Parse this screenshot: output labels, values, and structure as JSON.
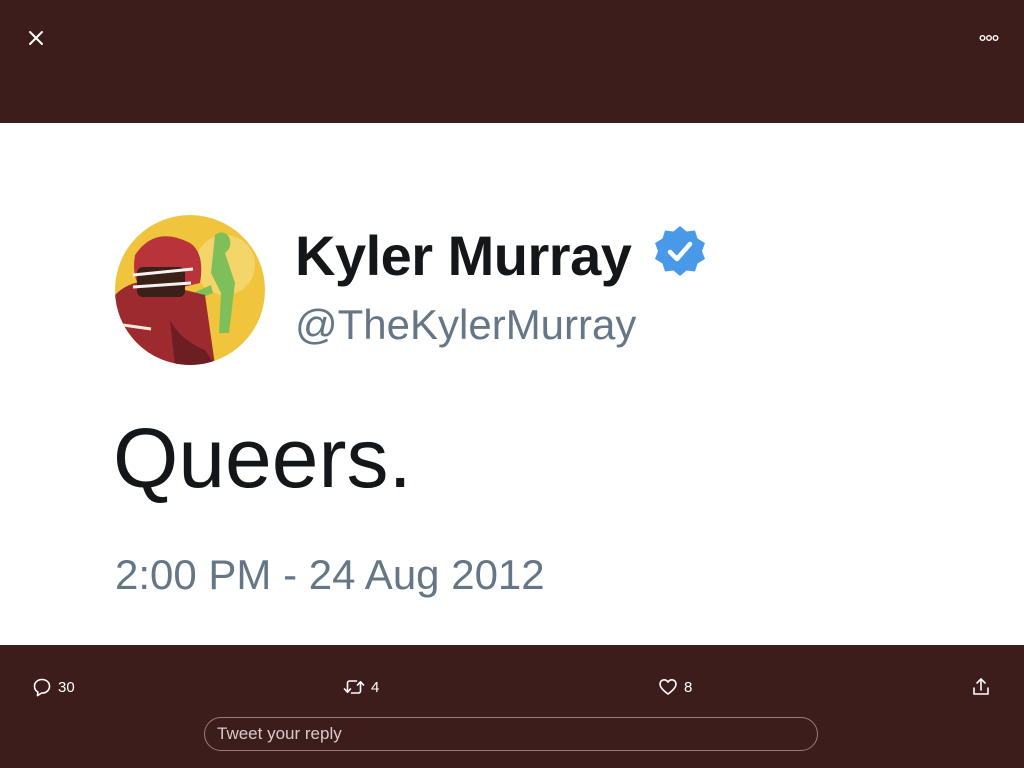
{
  "viewer": {
    "background_color": "#3d1d1b",
    "close_icon": "close-icon",
    "more_icon": "more-horizontal-icon"
  },
  "tweet_image": {
    "display_name": "Kyler Murray",
    "verified_icon": "verified-badge-icon",
    "verified_color": "#4a99e9",
    "handle": "@TheKylerMurray",
    "text": "Queers.",
    "timestamp": "2:00 PM - 24 Aug 2012"
  },
  "actions": {
    "reply": {
      "icon": "reply-icon",
      "count": "30"
    },
    "retweet": {
      "icon": "retweet-icon",
      "count": "4"
    },
    "like": {
      "icon": "heart-icon",
      "count": "8"
    },
    "share": {
      "icon": "share-icon"
    }
  },
  "reply_input": {
    "placeholder": "Tweet your reply",
    "value": ""
  }
}
